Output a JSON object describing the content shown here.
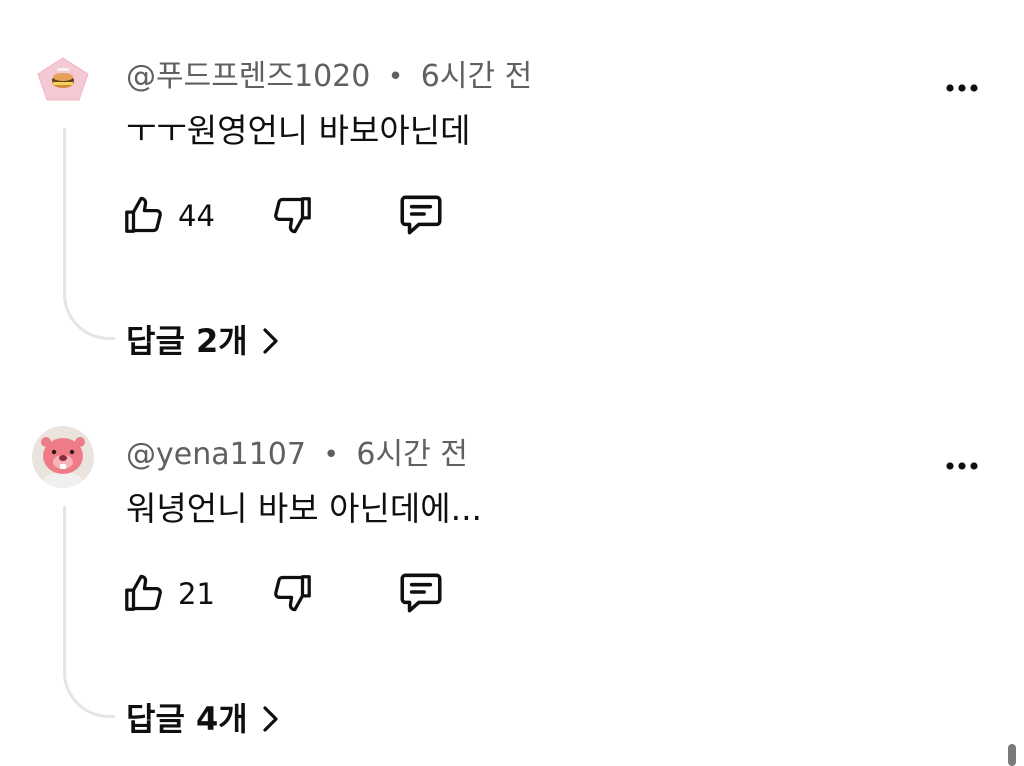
{
  "comments": [
    {
      "author": "@푸드프렌즈1020",
      "separator": "•",
      "time": "6시간 전",
      "text": "ㅜㅜ원영언니 바보아닌데",
      "likes": "44",
      "replies_label": "답글 2개",
      "avatar_icon": "food-friends-pentagon-avatar",
      "avatar_colors": {
        "background": "#f5c9d4",
        "accent": "#f2d45c"
      }
    },
    {
      "author": "@yena1107",
      "separator": "•",
      "time": "6시간 전",
      "text": "워녕언니 바보 아닌데에...",
      "likes": "21",
      "replies_label": "답글 4개",
      "avatar_icon": "pink-beaver-plush-avatar",
      "avatar_colors": {
        "background": "#e9e4de",
        "accent": "#ee7c86"
      }
    }
  ],
  "icons": {
    "like": "thumbs-up-icon",
    "dislike": "thumbs-down-icon",
    "reply": "comment-icon",
    "more": "more-vertical-icon",
    "chevron": "chevron-right-icon"
  },
  "colors": {
    "text_primary": "#0f0f0f",
    "text_secondary": "#606060",
    "thread_line": "#e5e5e5",
    "background": "#ffffff"
  }
}
